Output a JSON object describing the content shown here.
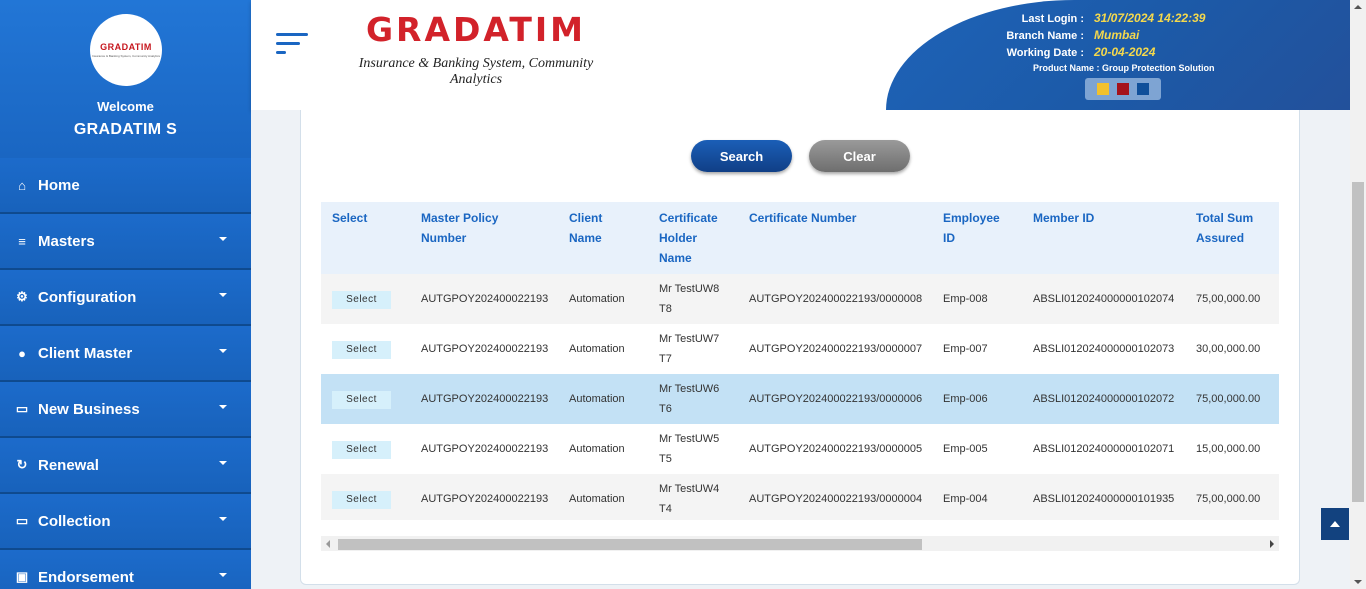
{
  "sidebar": {
    "logo_text": "GRADATIM",
    "logo_tagline": "Insurance & Banking System, Community Analytics",
    "welcome": "Welcome",
    "username": "GRADATIM S",
    "items": [
      {
        "label": "Home",
        "icon": "home-icon",
        "glyph": "⌂"
      },
      {
        "label": "Masters",
        "icon": "database-icon",
        "glyph": "≡"
      },
      {
        "label": "Configuration",
        "icon": "cogs-icon",
        "glyph": "⚙"
      },
      {
        "label": "Client Master",
        "icon": "user-icon",
        "glyph": "●"
      },
      {
        "label": "New Business",
        "icon": "desktop-icon",
        "glyph": "▭"
      },
      {
        "label": "Renewal",
        "icon": "refresh-icon",
        "glyph": "↻"
      },
      {
        "label": "Collection",
        "icon": "desktop-icon",
        "glyph": "▭"
      },
      {
        "label": "Endorsement",
        "icon": "briefcase-icon",
        "glyph": "▣"
      }
    ]
  },
  "header": {
    "brand_name": "GRADATIM",
    "brand_tagline": "Insurance & Banking System, Community Analytics",
    "last_login_label": "Last Login :",
    "last_login_value": "31/07/2024 14:22:39",
    "branch_label": "Branch Name :",
    "branch_value": "Mumbai",
    "working_date_label": "Working Date :",
    "working_date_value": "20-04-2024",
    "product": "Product Name : Group Protection Solution",
    "theme_colors": [
      "#f2c12e",
      "#a5121b",
      "#0f4f9a"
    ]
  },
  "actions": {
    "search_label": "Search",
    "clear_label": "Clear"
  },
  "table": {
    "headers": [
      "Select",
      "Master Policy Number",
      "Client Name",
      "Certificate Holder Name",
      "Certificate Number",
      "Employee ID",
      "Member ID",
      "Total Sum Assured"
    ],
    "select_label": "Select",
    "highlighted_row": 2,
    "rows": [
      [
        "AUTGPOY202400022193",
        "Automation",
        "Mr TestUW8 T8",
        "AUTGPOY202400022193/0000008",
        "Emp-008",
        "ABSLI012024000000102074",
        "75,00,000.00"
      ],
      [
        "AUTGPOY202400022193",
        "Automation",
        "Mr TestUW7 T7",
        "AUTGPOY202400022193/0000007",
        "Emp-007",
        "ABSLI012024000000102073",
        "30,00,000.00"
      ],
      [
        "AUTGPOY202400022193",
        "Automation",
        "Mr TestUW6 T6",
        "AUTGPOY202400022193/0000006",
        "Emp-006",
        "ABSLI012024000000102072",
        "75,00,000.00"
      ],
      [
        "AUTGPOY202400022193",
        "Automation",
        "Mr TestUW5 T5",
        "AUTGPOY202400022193/0000005",
        "Emp-005",
        "ABSLI012024000000102071",
        "15,00,000.00"
      ],
      [
        "AUTGPOY202400022193",
        "Automation",
        "Mr TestUW4 T4",
        "AUTGPOY202400022193/0000004",
        "Emp-004",
        "ABSLI012024000000101935",
        "75,00,000.00"
      ]
    ]
  }
}
